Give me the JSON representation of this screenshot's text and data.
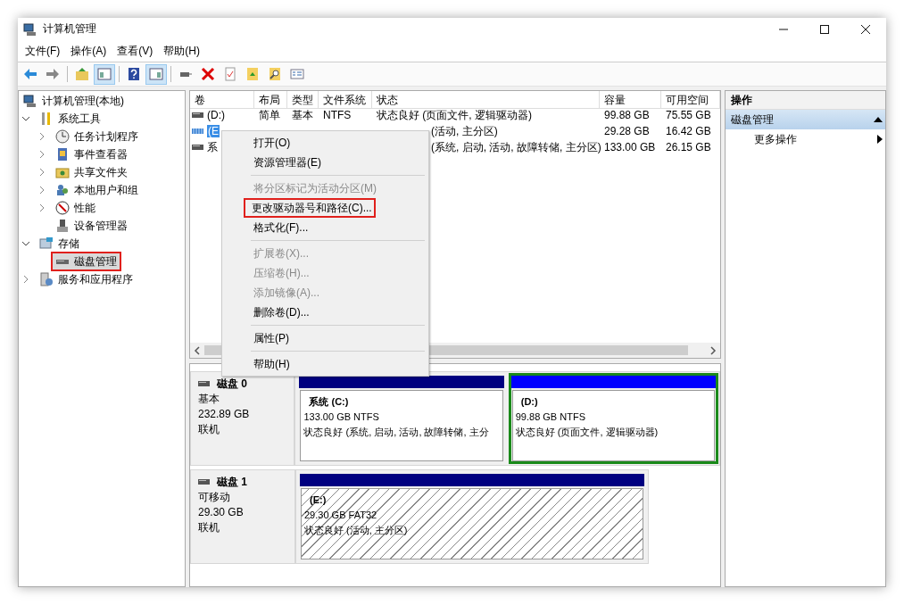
{
  "window": {
    "title": "计算机管理"
  },
  "menu": [
    "文件(F)",
    "操作(A)",
    "查看(V)",
    "帮助(H)"
  ],
  "toolbar": [
    {
      "kind": "back",
      "pressed": false
    },
    {
      "kind": "forward",
      "pressed": false
    },
    {
      "kind": "sep"
    },
    {
      "kind": "up",
      "pressed": false
    },
    {
      "kind": "tree",
      "pressed": true
    },
    {
      "kind": "sep"
    },
    {
      "kind": "help",
      "pressed": false
    },
    {
      "kind": "pane",
      "pressed": true
    },
    {
      "kind": "sep"
    },
    {
      "kind": "connect",
      "pressed": false
    },
    {
      "kind": "delete",
      "pressed": false
    },
    {
      "kind": "check",
      "pressed": false
    },
    {
      "kind": "upfolder",
      "pressed": false
    },
    {
      "kind": "find",
      "pressed": false
    },
    {
      "kind": "props",
      "pressed": false
    }
  ],
  "tree": [
    {
      "label": "计算机管理(本地)",
      "selected": false,
      "marked": false,
      "children": [
        {
          "label": "系统工具",
          "expanded": true,
          "selected": false,
          "marked": false,
          "children": [
            {
              "label": "任务计划程序",
              "expanded": false,
              "selected": false,
              "marked": false
            },
            {
              "label": "事件查看器",
              "expanded": false,
              "selected": false,
              "marked": false
            },
            {
              "label": "共享文件夹",
              "expanded": false,
              "selected": false,
              "marked": false
            },
            {
              "label": "本地用户和组",
              "expanded": false,
              "selected": false,
              "marked": false
            },
            {
              "label": "性能",
              "expanded": false,
              "selected": false,
              "marked": false
            },
            {
              "label": "设备管理器",
              "selected": false,
              "marked": false
            }
          ]
        },
        {
          "label": "存储",
          "expanded": true,
          "selected": false,
          "marked": false,
          "children": [
            {
              "label": "磁盘管理",
              "selected": true,
              "marked": true
            }
          ]
        },
        {
          "label": "服务和应用程序",
          "expanded": false,
          "selected": false,
          "marked": false
        }
      ]
    }
  ],
  "table": {
    "columns": [
      "卷",
      "布局",
      "类型",
      "文件系统",
      "状态",
      "容量",
      "可用空间"
    ],
    "rows": [
      {
        "selected": false,
        "kind": "fixed",
        "volume": "(D:)",
        "layout": "简单",
        "type": "基本",
        "fs": "NTFS",
        "status": "状态良好 (页面文件, 逻辑驱动器)",
        "capacity": "99.88 GB",
        "free": "75.55 GB"
      },
      {
        "selected": true,
        "kind": "removable",
        "volume": "(E",
        "status": "(活动, 主分区)",
        "capacity": "29.28 GB",
        "free": "16.42 GB"
      },
      {
        "selected": false,
        "kind": "fixed",
        "volume": "系",
        "status": "(系统, 启动, 活动, 故障转储, 主分区)",
        "capacity": "133.00 GB",
        "free": "26.15 GB"
      }
    ]
  },
  "context_menu": [
    {
      "kind": "item",
      "label": "打开(O)",
      "disabled": false,
      "marked": false
    },
    {
      "kind": "item",
      "label": "资源管理器(E)",
      "disabled": false,
      "marked": false
    },
    {
      "kind": "separator"
    },
    {
      "kind": "item",
      "label": "将分区标记为活动分区(M)",
      "disabled": true,
      "marked": false
    },
    {
      "kind": "item",
      "label": "更改驱动器号和路径(C)...",
      "disabled": false,
      "marked": true
    },
    {
      "kind": "item",
      "label": "格式化(F)...",
      "disabled": false,
      "marked": false
    },
    {
      "kind": "separator"
    },
    {
      "kind": "item",
      "label": "扩展卷(X)...",
      "disabled": true,
      "marked": false
    },
    {
      "kind": "item",
      "label": "压缩卷(H)...",
      "disabled": true,
      "marked": false
    },
    {
      "kind": "item",
      "label": "添加镜像(A)...",
      "disabled": true,
      "marked": false
    },
    {
      "kind": "item",
      "label": "删除卷(D)...",
      "disabled": false,
      "marked": false
    },
    {
      "kind": "separator"
    },
    {
      "kind": "item",
      "label": "属性(P)",
      "disabled": false,
      "marked": false
    },
    {
      "kind": "separator"
    },
    {
      "kind": "item",
      "label": "帮助(H)",
      "disabled": false,
      "marked": false
    }
  ],
  "disks": [
    {
      "name": "磁盘 0",
      "type": "基本",
      "size": "232.89 GB",
      "status": "联机",
      "partitions": [
        {
          "name": "系统  (C:)",
          "info": "133.00 GB NTFS",
          "status": "状态良好 (系统, 启动, 活动, 故障转储, 主分",
          "color": "#000080",
          "kind": "primary",
          "selected": false
        },
        {
          "name": "(D:)",
          "info": "99.88 GB NTFS",
          "status": "状态良好 (页面文件, 逻辑驱动器)",
          "color": "#0000ff",
          "kind": "logical",
          "selected": false
        }
      ]
    },
    {
      "name": "磁盘 1",
      "type": "可移动",
      "size": "29.30 GB",
      "status": "联机",
      "partitions": [
        {
          "name": "(E:)",
          "info": "29.30 GB FAT32",
          "status": "状态良好 (活动, 主分区)",
          "color": "#000080",
          "kind": "primary",
          "selected": true
        }
      ]
    }
  ],
  "actions": {
    "header": "操作",
    "sections": [
      {
        "title": "磁盘管理",
        "expanded": true,
        "items": [
          "更多操作"
        ]
      }
    ]
  }
}
